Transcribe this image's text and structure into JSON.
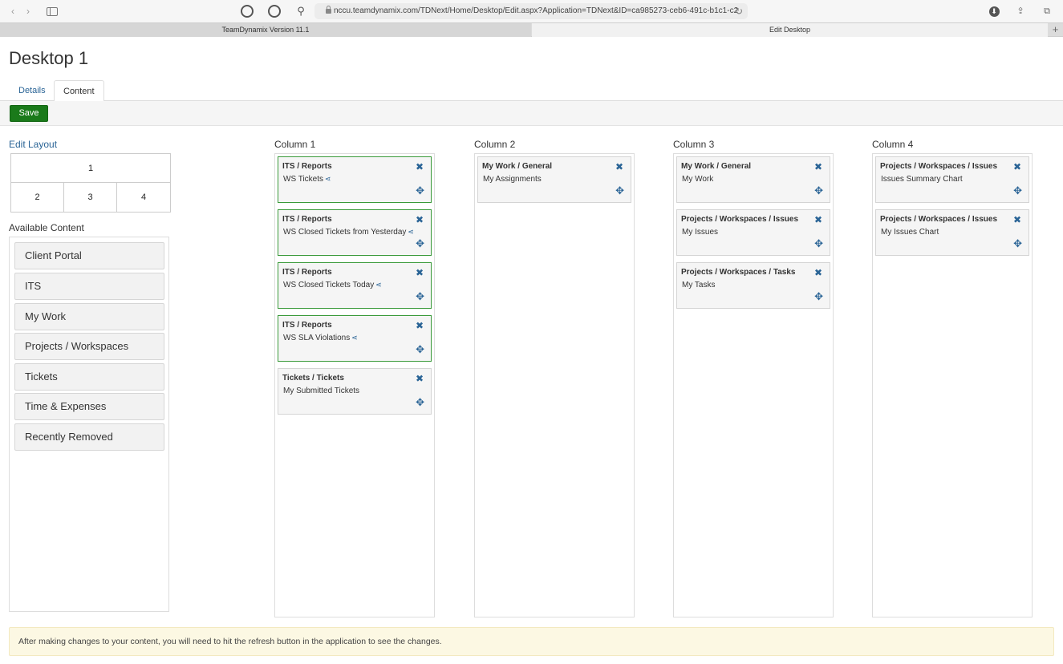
{
  "browser": {
    "url": "nccu.teamdynamix.com/TDNext/Home/Desktop/Edit.aspx?Application=TDNext&ID=ca985273-ceb6-491c-b1c1-c2",
    "tabs": [
      {
        "label": "TeamDynamix Version 11.1"
      },
      {
        "label": "Edit Desktop"
      }
    ],
    "icons": {
      "back": "‹",
      "forward": "›",
      "new_tab": "+",
      "reload": "↻",
      "download": "⬇",
      "share": "⇪",
      "tabs": "⧉",
      "ext3": "⚲"
    }
  },
  "page": {
    "title": "Desktop 1",
    "tabs": [
      {
        "label": "Details"
      },
      {
        "label": "Content"
      }
    ],
    "save_label": "Save",
    "edit_layout_label": "Edit Layout",
    "layout_cells": [
      "1",
      "2",
      "3",
      "4"
    ],
    "available_content_label": "Available Content",
    "available_content": [
      "Client Portal",
      "ITS",
      "My Work",
      "Projects / Workspaces",
      "Tickets",
      "Time & Expenses",
      "Recently Removed"
    ],
    "close_glyph": "✖",
    "move_glyph": "✥",
    "share_glyph": "⋖",
    "columns": [
      {
        "label": "Column 1",
        "cards": [
          {
            "category": "ITS / Reports",
            "name": "WS Tickets",
            "shared": true
          },
          {
            "category": "ITS / Reports",
            "name": "WS Closed Tickets from Yesterday",
            "shared": true
          },
          {
            "category": "ITS / Reports",
            "name": "WS Closed Tickets Today",
            "shared": true
          },
          {
            "category": "ITS / Reports",
            "name": "WS SLA Violations",
            "shared": true
          },
          {
            "category": "Tickets / Tickets",
            "name": "My Submitted Tickets",
            "shared": false
          }
        ]
      },
      {
        "label": "Column 2",
        "cards": [
          {
            "category": "My Work / General",
            "name": "My Assignments",
            "shared": false
          }
        ]
      },
      {
        "label": "Column 3",
        "cards": [
          {
            "category": "My Work / General",
            "name": "My Work",
            "shared": false
          },
          {
            "category": "Projects / Workspaces / Issues",
            "name": "My Issues",
            "shared": false
          },
          {
            "category": "Projects / Workspaces / Tasks",
            "name": "My Tasks",
            "shared": false
          }
        ]
      },
      {
        "label": "Column 4",
        "cards": [
          {
            "category": "Projects / Workspaces / Issues",
            "name": "Issues Summary Chart",
            "shared": false
          },
          {
            "category": "Projects / Workspaces / Issues",
            "name": "My Issues Chart",
            "shared": false
          }
        ]
      }
    ],
    "notice": "After making changes to your content, you will need to hit the refresh button in the application to see the changes."
  },
  "colors": {
    "save_green": "#1a7a1a",
    "link_blue": "#2a6496",
    "shared_card_border": "#3a9a3a",
    "notice_bg": "#fcf8e3"
  }
}
